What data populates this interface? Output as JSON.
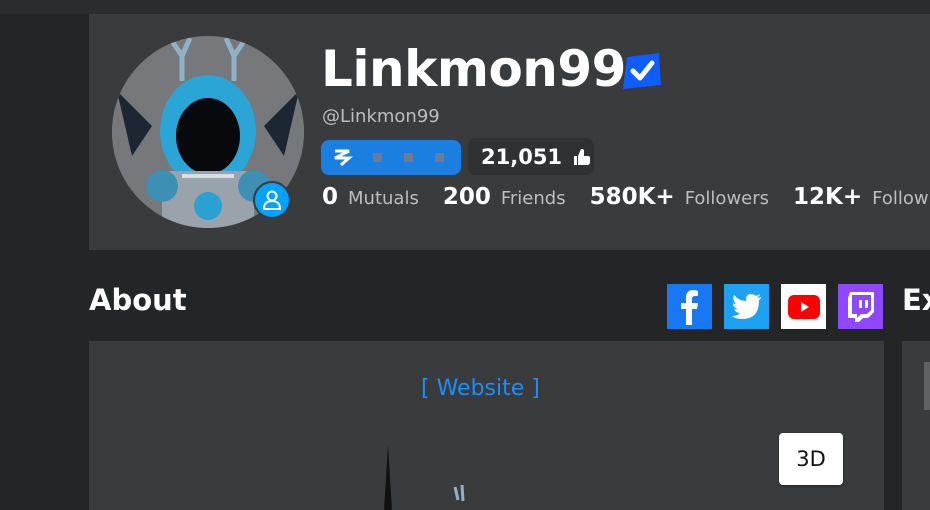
{
  "profile": {
    "display_name": "Linkmon99",
    "username": "@Linkmon99",
    "likes": "21,051",
    "stats": [
      {
        "value": "0",
        "label": "Mutuals"
      },
      {
        "value": "200",
        "label": "Friends"
      },
      {
        "value": "580K+",
        "label": "Followers"
      },
      {
        "value": "12K+",
        "label": "Following"
      }
    ]
  },
  "about": {
    "heading": "About",
    "website_link": "[ Website ]",
    "view_3d_label": "3D"
  },
  "right_panel": {
    "heading_fragment": "Ex"
  },
  "social_links": [
    {
      "name": "facebook",
      "color": "#1877f2"
    },
    {
      "name": "twitter",
      "color": "#1da1f2"
    },
    {
      "name": "youtube",
      "color": "#ffffff"
    },
    {
      "name": "twitch",
      "color": "#9146ff"
    }
  ],
  "colors": {
    "background": "#232527",
    "card": "#393b3d",
    "accent_blue": "#00a2ff",
    "link_blue": "#1a8fff"
  },
  "icons": [
    "verified-icon",
    "premium-icon",
    "thumbs-up-icon",
    "presence-user-icon",
    "facebook-icon",
    "twitter-icon",
    "youtube-icon",
    "twitch-icon"
  ]
}
